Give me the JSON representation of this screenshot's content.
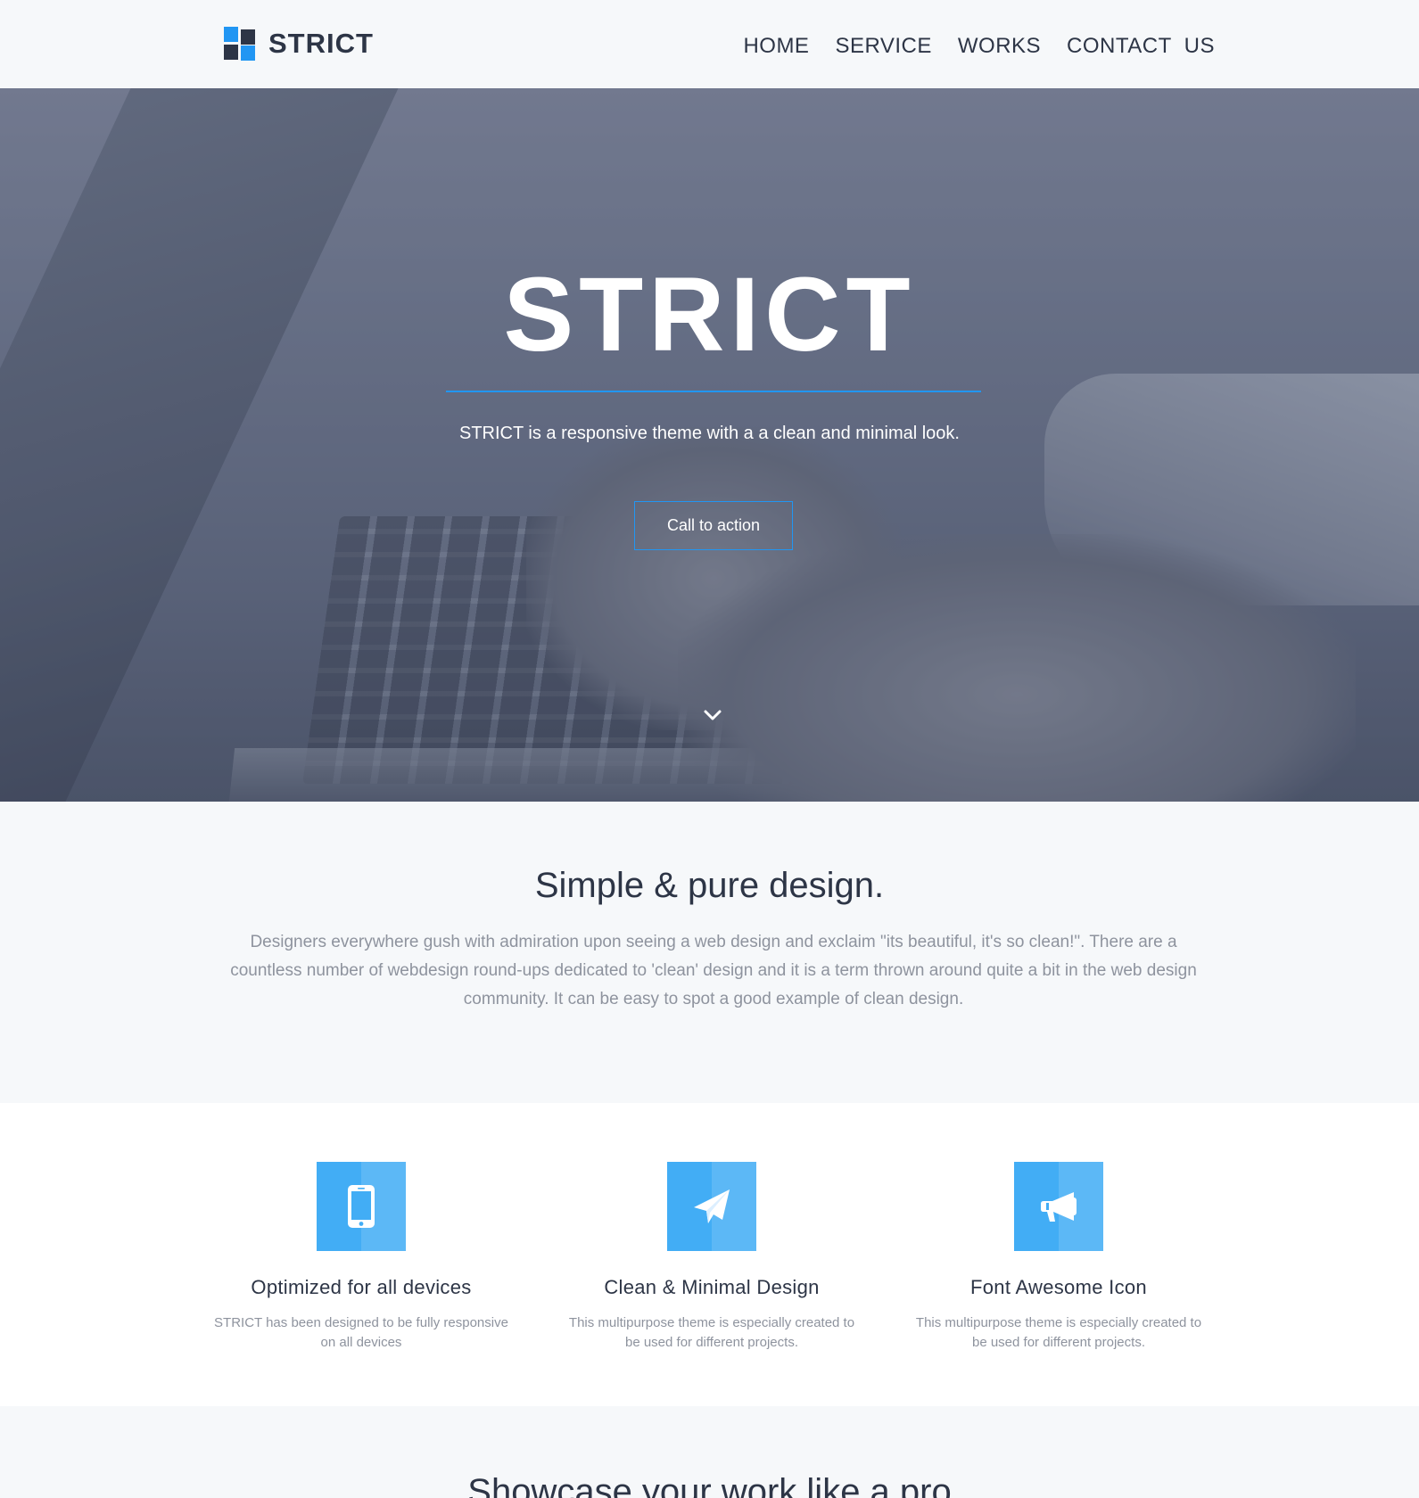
{
  "brand": {
    "name": "STRICT",
    "accent": "#2196f3",
    "dark": "#2d3546"
  },
  "nav": {
    "items": [
      "HOME",
      "SERVICE",
      "WORKS",
      "CONTACT  US"
    ]
  },
  "hero": {
    "title": "STRICT",
    "subtitle": "STRICT is a responsive theme with a a clean and minimal look.",
    "cta_label": "Call to action",
    "scroll_icon": "chevron-down-icon"
  },
  "intro": {
    "heading": "Simple & pure design.",
    "body": "Designers everywhere gush with admiration upon seeing a web design and exclaim \"its beautiful, it's so clean!\". There are a countless number of webdesign round-ups dedicated to 'clean' design and it is a term thrown around quite a bit in the web design community. It can be easy to spot a good example of clean design."
  },
  "features": [
    {
      "icon": "mobile-phone-icon",
      "title": "Optimized for all devices",
      "text": "STRICT has been designed to be fully responsive on all devices"
    },
    {
      "icon": "paper-plane-icon",
      "title": "Clean & Minimal Design",
      "text": "This multipurpose theme is especially created to be used for different projects."
    },
    {
      "icon": "megaphone-icon",
      "title": "Font Awesome Icon",
      "text": "This multipurpose theme is especially created to be used for different projects."
    }
  ],
  "showcase": {
    "heading": "Showcase your work like a pro"
  }
}
